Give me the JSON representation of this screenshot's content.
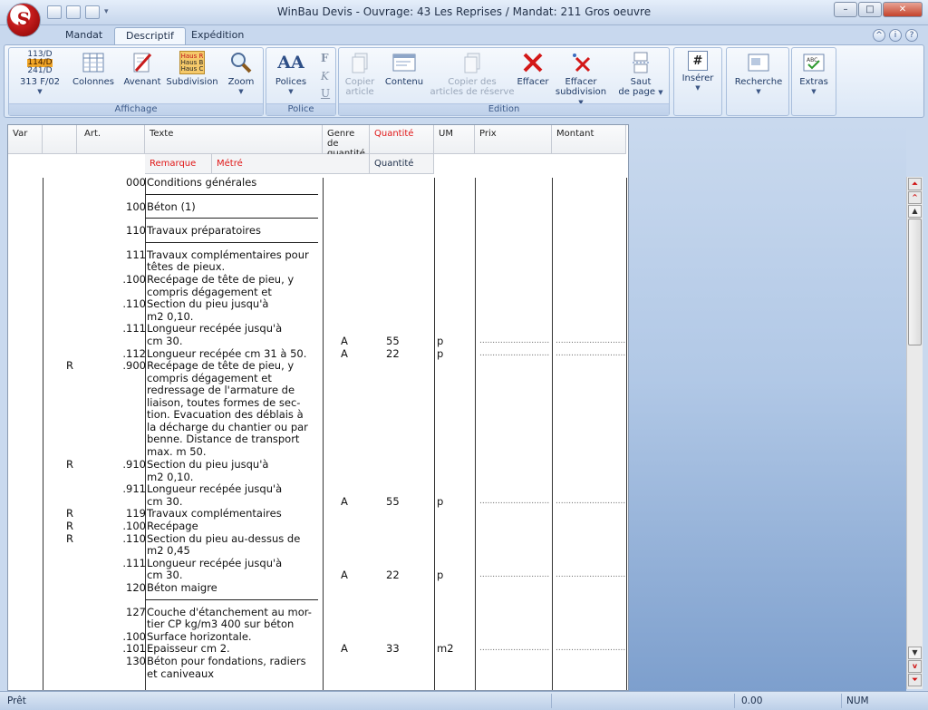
{
  "window": {
    "title": "WinBau Devis - Ouvrage: 43 Les Reprises / Mandat: 211 Gros oeuvre",
    "buttons": {
      "minimize": "–",
      "maximize": "□",
      "close": "✕"
    }
  },
  "tabs": [
    {
      "label": "Mandat",
      "active": false
    },
    {
      "label": "Descriptif",
      "active": true
    },
    {
      "label": "Expédition",
      "active": false
    }
  ],
  "ribbon": {
    "groups": {
      "affichage": "Affichage",
      "police": "Police",
      "edition": "Edition"
    },
    "numbers_icon": [
      "113/D",
      "114/D",
      "241/D"
    ],
    "subdiv_icon": [
      "Haus R",
      "Haus B",
      "Haus C"
    ],
    "buttons": {
      "numbering": "313 F/02",
      "colonnes": "Colonnes",
      "avenant": "Avenant",
      "subdivision": "Subdivision",
      "zoom": "Zoom",
      "polices": "Polices",
      "copier_article_1": "Copier",
      "copier_article_2": "article",
      "contenu": "Contenu",
      "copier_reserve_1": "Copier des",
      "copier_reserve_2": "articles de réserve",
      "effacer": "Effacer",
      "effacer_subdiv_1": "Effacer",
      "effacer_subdiv_2": "subdivision",
      "saut_1": "Saut",
      "saut_2": "de page",
      "inserer": "Insérer",
      "recherche": "Recherche",
      "extras": "Extras"
    },
    "font_styles": [
      "F",
      "K",
      "U"
    ]
  },
  "columns": {
    "var": "Var",
    "art": "Art.",
    "texte": "Texte",
    "genre": "Genre de quantité",
    "quantite": "Quantité",
    "um": "UM",
    "prix": "Prix",
    "montant": "Montant",
    "remarque": "Remarque",
    "metre": "Métré",
    "quantite2": "Quantité"
  },
  "rows": [
    {
      "var": "",
      "art": "000",
      "text": "Conditions générales",
      "genre": "",
      "qte": "",
      "um": "",
      "price": false,
      "line": true
    },
    {
      "var": "",
      "art": "100",
      "text": "Béton (1)",
      "genre": "",
      "qte": "",
      "um": "",
      "price": false,
      "line": true
    },
    {
      "var": "",
      "art": "110",
      "text": "Travaux préparatoires",
      "genre": "",
      "qte": "",
      "um": "",
      "price": false,
      "line": true
    },
    {
      "var": "",
      "art": "111",
      "text": "Travaux complémentaires pour\ntêtes de pieux.",
      "genre": "",
      "qte": "",
      "um": "",
      "price": false
    },
    {
      "var": "",
      "art": ".100",
      "text": "Recépage de tête de pieu, y\ncompris dégagement et",
      "genre": "",
      "qte": "",
      "um": "",
      "price": false
    },
    {
      "var": "",
      "art": ".110",
      "text": "Section du pieu jusqu'à\nm2 0,10.",
      "genre": "",
      "qte": "",
      "um": "",
      "price": false
    },
    {
      "var": "",
      "art": ".111",
      "text": "Longueur recépée jusqu'à\ncm 30.",
      "genre": "A",
      "qte": "55",
      "um": "p",
      "price": true
    },
    {
      "var": "",
      "art": ".112",
      "text": "Longueur recépée cm 31 à 50.",
      "genre": "A",
      "qte": "22",
      "um": "p",
      "price": true
    },
    {
      "var": "R",
      "art": ".900",
      "text": "Recépage de tête de pieu, y\ncompris dégagement et\nredressage de l'armature de\nliaison, toutes formes de sec-\ntion. Evacuation des déblais à\nla décharge du chantier ou par\nbenne. Distance de transport\nmax. m 50.",
      "genre": "",
      "qte": "",
      "um": "",
      "price": false
    },
    {
      "var": "R",
      "art": ".910",
      "text": "Section du pieu jusqu'à\nm2 0,10.",
      "genre": "",
      "qte": "",
      "um": "",
      "price": false
    },
    {
      "var": "",
      "art": ".911",
      "text": "Longueur recépée jusqu'à\ncm 30.",
      "genre": "A",
      "qte": "55",
      "um": "p",
      "price": true
    },
    {
      "var": "R",
      "art": "119",
      "text": "Travaux complémentaires",
      "genre": "",
      "qte": "",
      "um": "",
      "price": false
    },
    {
      "var": "R",
      "art": ".100",
      "text": "Recépage",
      "genre": "",
      "qte": "",
      "um": "",
      "price": false
    },
    {
      "var": "R",
      "art": ".110",
      "text": "Section du pieu au-dessus de\nm2 0,45",
      "genre": "",
      "qte": "",
      "um": "",
      "price": false
    },
    {
      "var": "",
      "art": ".111",
      "text": "Longueur recépée jusqu'à\ncm 30.",
      "genre": "A",
      "qte": "22",
      "um": "p",
      "price": true
    },
    {
      "var": "",
      "art": "120",
      "text": "Béton maigre",
      "genre": "",
      "qte": "",
      "um": "",
      "price": false,
      "line": true
    },
    {
      "var": "",
      "art": "127",
      "text": "Couche d'étanchement au mor-\ntier CP kg/m3 400 sur béton",
      "genre": "",
      "qte": "",
      "um": "",
      "price": false
    },
    {
      "var": "",
      "art": ".100",
      "text": "Surface horizontale.",
      "genre": "",
      "qte": "",
      "um": "",
      "price": false
    },
    {
      "var": "",
      "art": ".101",
      "text": "Epaisseur cm 2.",
      "genre": "A",
      "qte": "33",
      "um": "m2",
      "price": true
    },
    {
      "var": "",
      "art": "130",
      "text": "Béton pour fondations, radiers\net caniveaux",
      "genre": "",
      "qte": "",
      "um": "",
      "price": false
    }
  ],
  "dotted": "...........................",
  "status": {
    "text": "Prêt",
    "value": "0.00",
    "num": "NUM"
  }
}
